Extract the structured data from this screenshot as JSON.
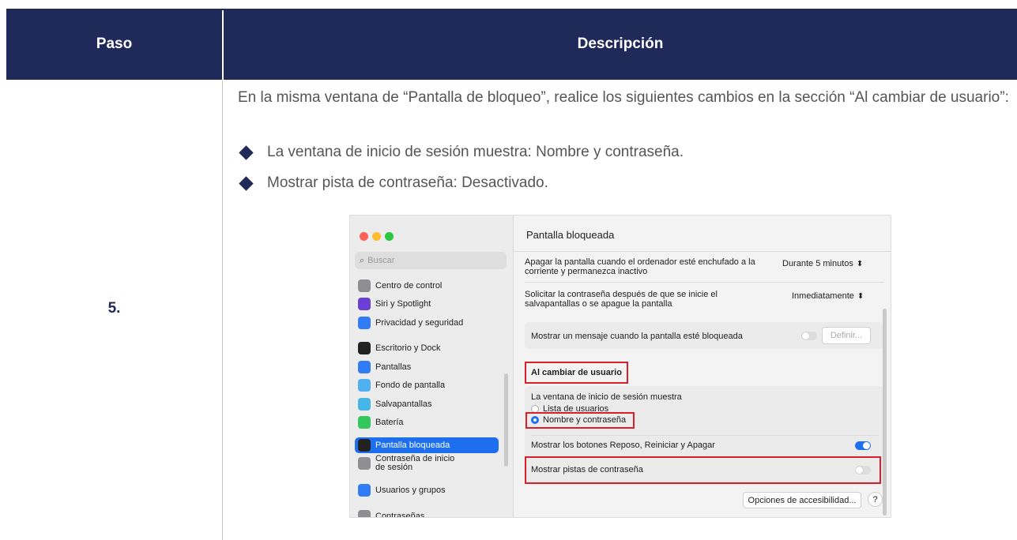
{
  "table": {
    "header": {
      "col1": "Paso",
      "col2": "Descripción"
    },
    "step": "5.",
    "description": "En la misma ventana de “Pantalla de bloqueo”, realice los siguientes cambios en la sección “Al cambiar de usuario”:",
    "bullets": [
      "La ventana de inicio de sesión muestra: Nombre y contraseña.",
      "Mostrar pista de contraseña: Desactivado."
    ]
  },
  "screenshot": {
    "search_placeholder": "Buscar",
    "sidebar": [
      {
        "label": "Centro de control",
        "icon": "control-center-icon",
        "color": "#8e8e93"
      },
      {
        "label": "Siri y Spotlight",
        "icon": "siri-icon",
        "color": "#6b3fd3"
      },
      {
        "label": "Privacidad y seguridad",
        "icon": "hand-icon",
        "color": "#2f7cf6"
      },
      {
        "label": "Escritorio y Dock",
        "icon": "dock-icon",
        "color": "#222222"
      },
      {
        "label": "Pantallas",
        "icon": "sun-icon",
        "color": "#2f7cf6"
      },
      {
        "label": "Fondo de pantalla",
        "icon": "wallpaper-icon",
        "color": "#4fb1f0"
      },
      {
        "label": "Salvapantallas",
        "icon": "screensaver-icon",
        "color": "#46b5e8"
      },
      {
        "label": "Batería",
        "icon": "battery-icon",
        "color": "#34c759"
      },
      {
        "label": "Pantalla bloqueada",
        "icon": "lock-screen-icon",
        "color": "#222222"
      },
      {
        "label": "Contraseña de inicio\nde sesión",
        "icon": "lock-icon",
        "color": "#8e8e93"
      },
      {
        "label": "Usuarios y grupos",
        "icon": "users-icon",
        "color": "#2f7cf6"
      },
      {
        "label": "Contraseñas",
        "icon": "key-icon",
        "color": "#8e8e93"
      }
    ],
    "title": "Pantalla bloqueada",
    "row_display_off": "Apagar la pantalla cuando el ordenador esté enchufado a la corriente y permanezca inactivo",
    "row_display_off_value": "Durante 5 minutos",
    "row_require_password": "Solicitar la contraseña después de que se inicie el salvapantallas o se apague la pantalla",
    "row_require_password_value": "Inmediatamente",
    "row_message": "Mostrar un mensaje cuando la pantalla esté bloqueada",
    "row_message_button": "Definir...",
    "section_title": "Al cambiar de usuario",
    "login_window_label": "La ventana de inicio de sesión muestra",
    "radio_list": "Lista de usuarios",
    "radio_name": "Nombre y contraseña",
    "row_buttons": "Mostrar los botones Reposo, Reiniciar y Apagar",
    "row_hints": "Mostrar pistas de contraseña",
    "accessibility_button": "Opciones de accesibilidad...",
    "help_button": "?",
    "accent": "#1e6ff0",
    "highlight": "#d9202a"
  }
}
